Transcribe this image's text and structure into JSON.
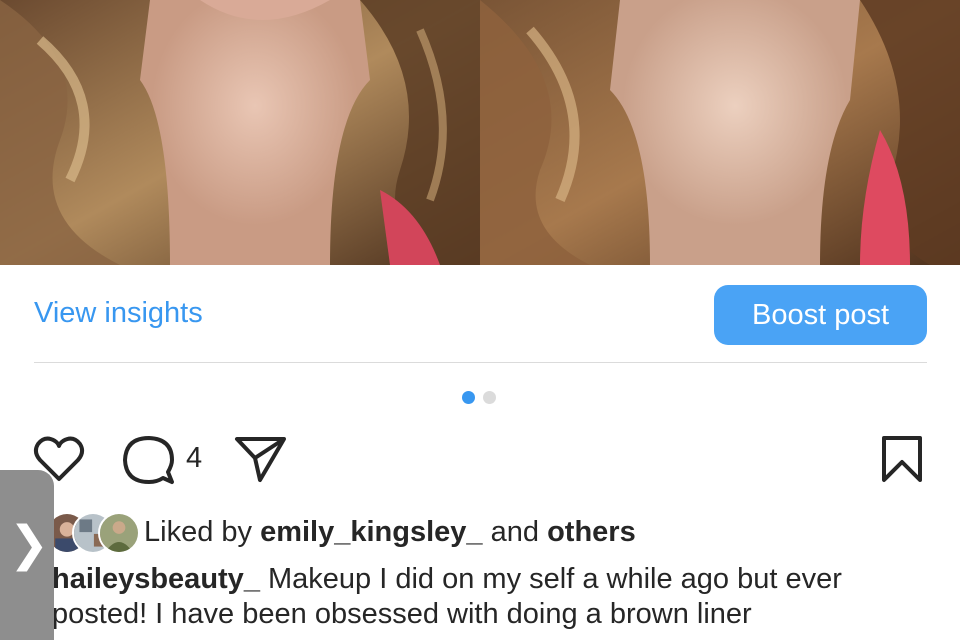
{
  "post": {
    "photos": [
      {
        "icon": "photo-portrait-left"
      },
      {
        "icon": "photo-portrait-right"
      }
    ],
    "view_insights_label": "View insights",
    "boost_post_label": "Boost post",
    "pagination": {
      "current": 1,
      "total": 2
    },
    "actions": {
      "like_icon": "heart-icon",
      "comment_icon": "comment-bubble-icon",
      "comment_count": "4",
      "share_icon": "paper-plane-icon",
      "save_icon": "bookmark-icon"
    },
    "likes": {
      "prefix": "Liked by",
      "user": "emily_kingsley_",
      "connector": "and",
      "others": "others"
    },
    "caption": {
      "username": "haileysbeauty_",
      "text": "Makeup I did on my self a while ago but ever posted! I have been obsessed with doing a brown liner"
    }
  },
  "drawer_handle": {
    "glyph": "❯"
  },
  "colors": {
    "accent": "#3897f0",
    "boost_button": "#4aa3f5",
    "divider": "#dbdbdb",
    "handle": "#8e8e8e"
  }
}
